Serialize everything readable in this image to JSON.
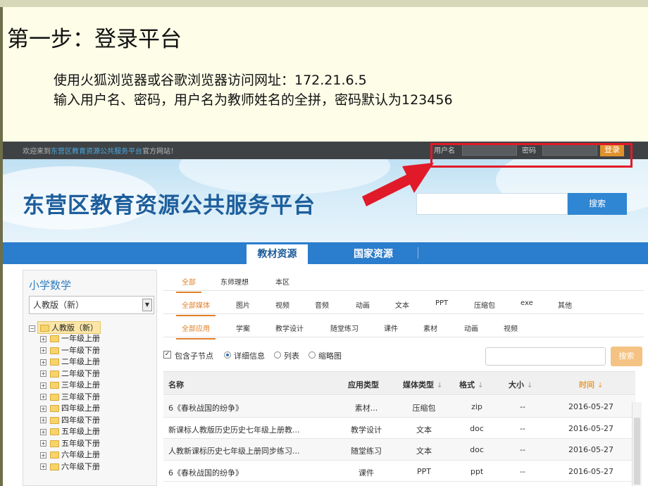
{
  "slide": {
    "title": "第一步：登录平台",
    "line1": "使用火狐浏览器或谷歌浏览器访问网址：172.21.6.5",
    "line2": "输入用户名、密码，用户名为教师姓名的全拼，密码默认为123456"
  },
  "topbar": {
    "welcome_pre": "欢迎来到",
    "welcome_link": "东营区教育资源公共服务平台",
    "welcome_post": "官方网站！",
    "username_label": "用户名",
    "password_label": "密码",
    "login_button": "登录"
  },
  "banner": {
    "title": "东营区教育资源公共服务平台",
    "search_button": "搜索"
  },
  "nav": {
    "tab_active": "教材资源",
    "tab_other": "国家资源"
  },
  "sidebar": {
    "title": "小学数学",
    "select_value": "人教版（新）",
    "tree_root": "人教版（新）",
    "tree_items": [
      "一年级上册",
      "一年级下册",
      "二年级上册",
      "二年级下册",
      "三年级上册",
      "三年级下册",
      "四年级上册",
      "四年级下册",
      "五年级上册",
      "五年级下册",
      "六年级上册",
      "六年级下册"
    ]
  },
  "filters": {
    "scope": [
      "全部",
      "东师理想",
      "本区"
    ],
    "media": [
      "全部媒体",
      "图片",
      "视频",
      "音频",
      "动画",
      "文本",
      "PPT",
      "压缩包",
      "exe",
      "其他"
    ],
    "apps": [
      "全部应用",
      "学案",
      "教学设计",
      "随堂练习",
      "课件",
      "素材",
      "动画",
      "视频"
    ]
  },
  "options": {
    "include_children": "包含子节点",
    "detail": "详细信息",
    "list": "列表",
    "thumb": "缩略图",
    "search_button": "搜索"
  },
  "table": {
    "headers": [
      "名称",
      "应用类型",
      "媒体类型",
      "格式",
      "大小",
      "时间"
    ],
    "sort_arrow": "↓",
    "rows": [
      [
        "6《春秋战国的纷争》",
        "素材...",
        "压缩包",
        "zip",
        "--",
        "2016-05-27"
      ],
      [
        "新课标人教版历史历史七年级上册教...",
        "教学设计",
        "文本",
        "doc",
        "--",
        "2016-05-27"
      ],
      [
        "人教新课标历史七年级上册同步练习...",
        "随堂练习",
        "文本",
        "doc",
        "--",
        "2016-05-27"
      ],
      [
        "6《春秋战国的纷争》",
        "课件",
        "PPT",
        "ppt",
        "--",
        "2016-05-27"
      ]
    ]
  },
  "colors": {
    "accent_orange": "#e0802a",
    "nav_blue": "#2b7dcd",
    "highlight_red": "#e11a2a"
  }
}
